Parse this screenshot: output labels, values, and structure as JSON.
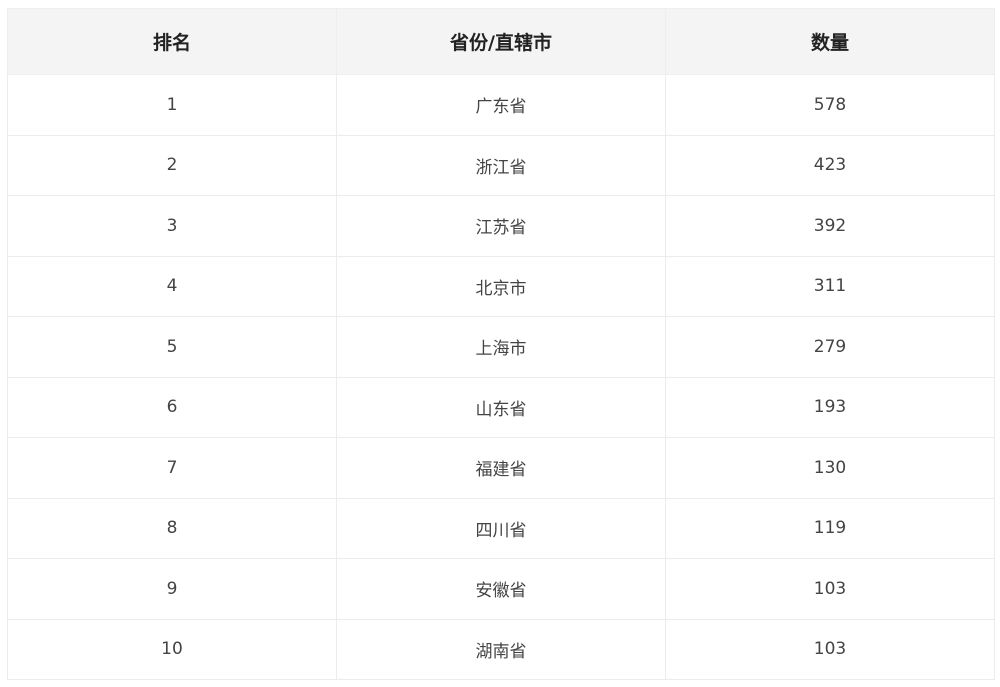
{
  "table": {
    "headers": [
      "排名",
      "省份/直辖市",
      "数量"
    ],
    "rows": [
      [
        "1",
        "广东省",
        "578"
      ],
      [
        "2",
        "浙江省",
        "423"
      ],
      [
        "3",
        "江苏省",
        "392"
      ],
      [
        "4",
        "北京市",
        "311"
      ],
      [
        "5",
        "上海市",
        "279"
      ],
      [
        "6",
        "山东省",
        "193"
      ],
      [
        "7",
        "福建省",
        "130"
      ],
      [
        "8",
        "四川省",
        "119"
      ],
      [
        "9",
        "安徽省",
        "103"
      ],
      [
        "10",
        "湖南省",
        "103"
      ]
    ]
  }
}
